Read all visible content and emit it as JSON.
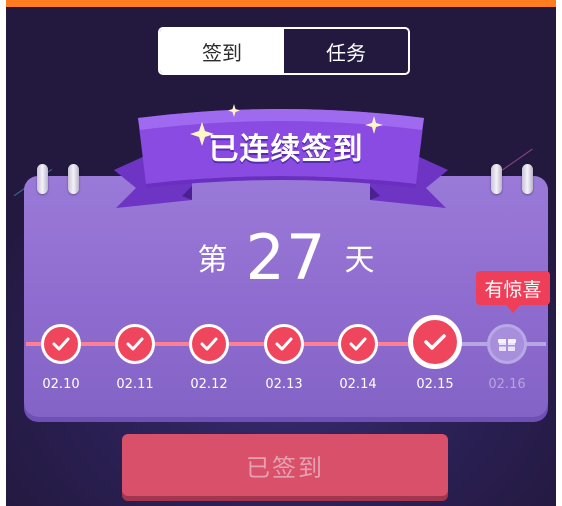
{
  "colors": {
    "accent_orange": "#ff7d1f",
    "background": "#23193f",
    "card": "#9a7ad8",
    "checked": "#f0465d",
    "button": "#d8506a"
  },
  "tabs": [
    {
      "label": "签到",
      "active": true
    },
    {
      "label": "任务",
      "active": false
    }
  ],
  "banner": {
    "title": "已连续签到"
  },
  "streak": {
    "prefix": "第",
    "count": "27",
    "suffix": "天"
  },
  "badge": {
    "label": "有惊喜"
  },
  "days": [
    {
      "date": "02.10",
      "status": "checked"
    },
    {
      "date": "02.11",
      "status": "checked"
    },
    {
      "date": "02.12",
      "status": "checked"
    },
    {
      "date": "02.13",
      "status": "checked"
    },
    {
      "date": "02.14",
      "status": "checked"
    },
    {
      "date": "02.15",
      "status": "today-checked"
    },
    {
      "date": "02.16",
      "status": "gift"
    }
  ],
  "button": {
    "label": "已签到",
    "enabled": false
  },
  "icons": {
    "check": "check-icon",
    "gift": "gift-icon",
    "sparkle": "sparkle-icon"
  }
}
